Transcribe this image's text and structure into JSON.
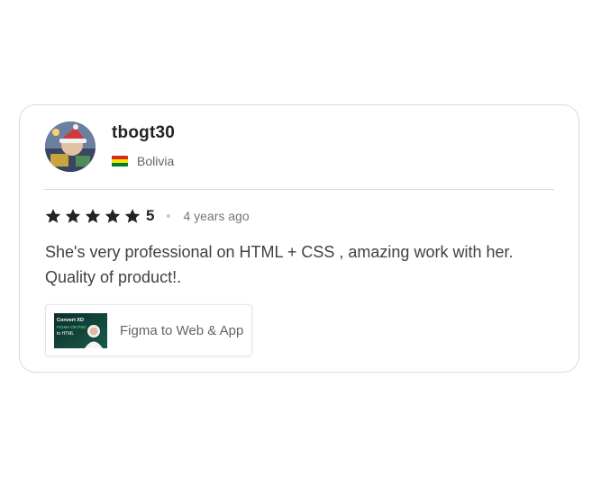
{
  "review": {
    "username": "tbogt30",
    "country": "Bolivia",
    "flag_colors": [
      "#d52b1e",
      "#f9e300",
      "#007934"
    ],
    "rating": "5",
    "stars_filled": 5,
    "stars_total": 5,
    "time_ago": "4 years ago",
    "text": "She's very professional on HTML + CSS , amazing work with her. Quality of product!.",
    "gig": {
      "title": "Figma to Web & App",
      "thumbnail_text": [
        "Convert XD",
        "FIGMA OR PSD",
        "to HTML"
      ]
    }
  },
  "colors": {
    "star": "#222325",
    "border": "#dadbdd"
  }
}
